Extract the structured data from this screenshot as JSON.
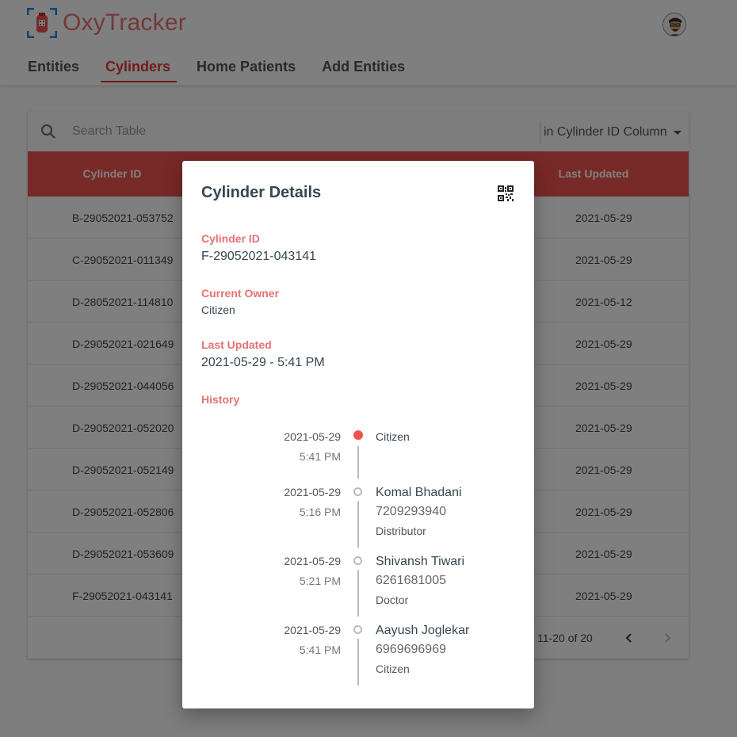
{
  "app": {
    "brand": "OxyTracker"
  },
  "nav": {
    "tabs": [
      {
        "label": "Entities",
        "active": false
      },
      {
        "label": "Cylinders",
        "active": true
      },
      {
        "label": "Home Patients",
        "active": false
      },
      {
        "label": "Add Entities",
        "active": false
      }
    ]
  },
  "search": {
    "placeholder": "Search Table",
    "column_selector": "in Cylinder ID Column"
  },
  "table": {
    "headers": {
      "cylinder_id": "Cylinder ID",
      "last_updated": "Last Updated"
    },
    "rows": [
      {
        "cylinder_id": "B-29052021-053752",
        "last_updated": "2021-05-29"
      },
      {
        "cylinder_id": "C-29052021-011349",
        "last_updated": "2021-05-29"
      },
      {
        "cylinder_id": "D-28052021-114810",
        "last_updated": "2021-05-12"
      },
      {
        "cylinder_id": "D-29052021-021649",
        "last_updated": "2021-05-29"
      },
      {
        "cylinder_id": "D-29052021-044056",
        "last_updated": "2021-05-29"
      },
      {
        "cylinder_id": "D-29052021-052020",
        "last_updated": "2021-05-29"
      },
      {
        "cylinder_id": "D-29052021-052149",
        "last_updated": "2021-05-29"
      },
      {
        "cylinder_id": "D-29052021-052806",
        "last_updated": "2021-05-29"
      },
      {
        "cylinder_id": "D-29052021-053609",
        "last_updated": "2021-05-29"
      },
      {
        "cylinder_id": "F-29052021-043141",
        "last_updated": "2021-05-29"
      }
    ],
    "pagination": {
      "range": "11-20 of 20"
    }
  },
  "modal": {
    "title": "Cylinder Details",
    "fields": {
      "cylinder_id_label": "Cylinder ID",
      "cylinder_id_value": "F-29052021-043141",
      "owner_label": "Current Owner",
      "owner_value": "Citizen",
      "last_updated_label": "Last Updated",
      "last_updated_value": "2021-05-29 - 5:41 PM",
      "history_label": "History"
    },
    "history": [
      {
        "date": "2021-05-29",
        "time": "5:41 PM",
        "name": "Citizen",
        "phone": "",
        "role": ""
      },
      {
        "date": "2021-05-29",
        "time": "5:16 PM",
        "name": "Komal Bhadani",
        "phone": "7209293940",
        "role": "Distributor"
      },
      {
        "date": "2021-05-29",
        "time": "5:21 PM",
        "name": "Shivansh Tiwari",
        "phone": "6261681005",
        "role": "Doctor"
      },
      {
        "date": "2021-05-29",
        "time": "5:41 PM",
        "name": "Aayush Joglekar",
        "phone": "6969696969",
        "role": "Citizen"
      }
    ]
  },
  "colors": {
    "brand": "#e57373",
    "accent": "#ef5350",
    "active_tab": "#e53935"
  },
  "icons": [
    "logo-icon",
    "avatar-icon",
    "search-icon",
    "caret-down-icon",
    "chevron-left-icon",
    "chevron-right-icon",
    "qr-code-icon"
  ]
}
